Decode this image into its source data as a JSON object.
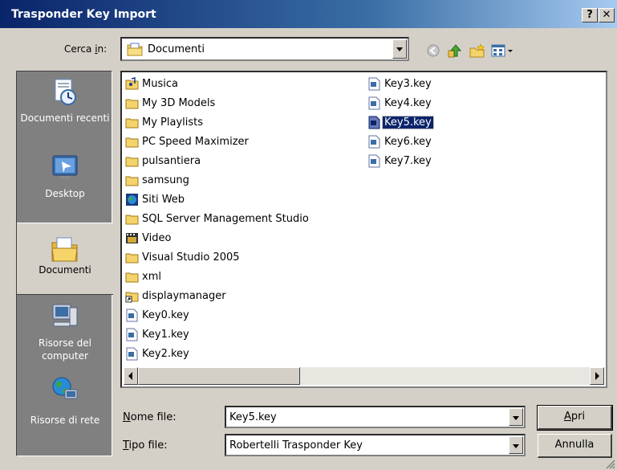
{
  "window": {
    "title": "Trasponder Key Import",
    "help_label": "?",
    "close_label": "✕"
  },
  "lookin": {
    "label_prefix": "Cerca ",
    "label_accel": "i",
    "label_suffix": "n:",
    "value": "Documenti"
  },
  "places": [
    {
      "label": "Documenti recenti",
      "icon": "recent-documents-icon"
    },
    {
      "label": "Desktop",
      "icon": "desktop-icon"
    },
    {
      "label": "Documenti",
      "icon": "my-documents-icon"
    },
    {
      "label": "Risorse del computer",
      "icon": "my-computer-icon"
    },
    {
      "label": "Risorse di rete",
      "icon": "network-places-icon"
    }
  ],
  "files": {
    "col1": [
      {
        "name": "Musica",
        "type": "folder-music"
      },
      {
        "name": "My 3D Models",
        "type": "folder"
      },
      {
        "name": "My Playlists",
        "type": "folder"
      },
      {
        "name": "PC Speed Maximizer",
        "type": "folder"
      },
      {
        "name": "pulsantiera",
        "type": "folder"
      },
      {
        "name": "samsung",
        "type": "folder"
      },
      {
        "name": "Siti Web",
        "type": "folder-web"
      },
      {
        "name": "SQL Server Management Studio",
        "type": "folder"
      },
      {
        "name": "Video",
        "type": "folder-video"
      },
      {
        "name": "Visual Studio 2005",
        "type": "folder"
      },
      {
        "name": "xml",
        "type": "folder"
      },
      {
        "name": "displaymanager",
        "type": "folder-shortcut"
      },
      {
        "name": "Key0.key",
        "type": "file"
      },
      {
        "name": "Key1.key",
        "type": "file"
      },
      {
        "name": "Key2.key",
        "type": "file"
      }
    ],
    "col2": [
      {
        "name": "Key3.key",
        "type": "file"
      },
      {
        "name": "Key4.key",
        "type": "file"
      },
      {
        "name": "Key5.key",
        "type": "file",
        "selected": true
      },
      {
        "name": "Key6.key",
        "type": "file"
      },
      {
        "name": "Key7.key",
        "type": "file"
      }
    ]
  },
  "filename": {
    "label_accel": "N",
    "label_rest": "ome file:",
    "value": "Key5.key"
  },
  "filetype": {
    "label_accel": "T",
    "label_rest": "ipo file:",
    "value": "Robertelli Trasponder Key"
  },
  "buttons": {
    "open_accel": "A",
    "open_rest": "pri",
    "cancel": "Annulla"
  },
  "colors": {
    "title_start": "#0a246a",
    "title_end": "#a6caf0",
    "face": "#d4d0c8",
    "selection": "#0a246a",
    "places_bg": "#808080"
  }
}
